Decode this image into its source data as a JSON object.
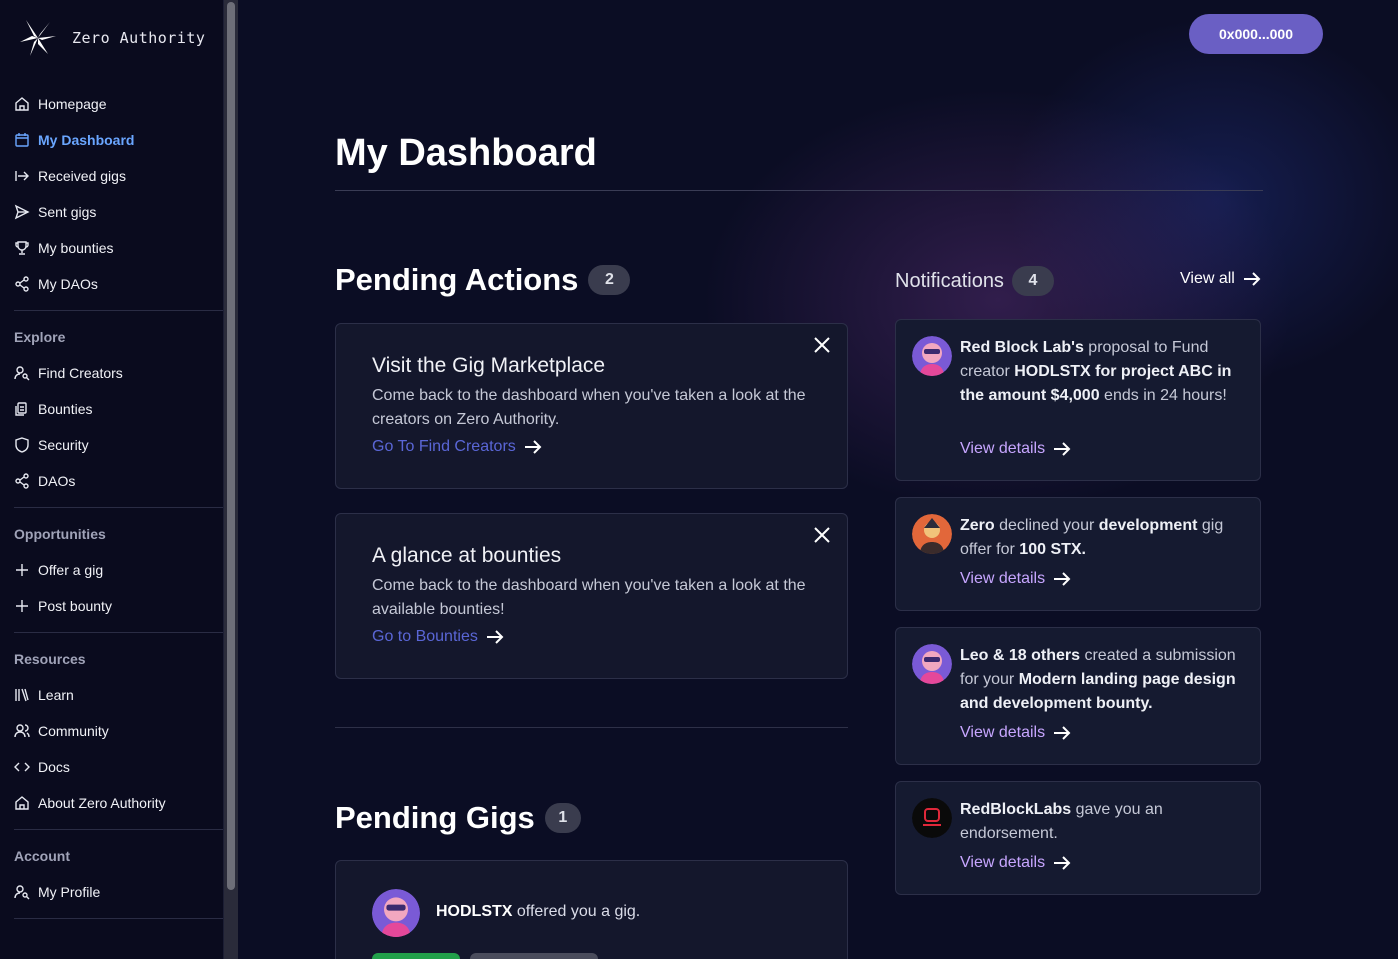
{
  "app": {
    "name": "Zero Authority"
  },
  "sidebar": {
    "primary": [
      {
        "label": "Homepage",
        "icon": "home-icon"
      },
      {
        "label": "My Dashboard",
        "icon": "calendar-icon",
        "active": true
      },
      {
        "label": "Received gigs",
        "icon": "arrow-in-icon"
      },
      {
        "label": "Sent gigs",
        "icon": "send-icon"
      },
      {
        "label": "My bounties",
        "icon": "trophy-icon"
      },
      {
        "label": "My DAOs",
        "icon": "share-icon"
      }
    ],
    "explore": {
      "heading": "Explore",
      "items": [
        {
          "label": "Find Creators",
          "icon": "user-search-icon"
        },
        {
          "label": "Bounties",
          "icon": "bounty-icon"
        },
        {
          "label": "Security",
          "icon": "shield-icon"
        },
        {
          "label": "DAOs",
          "icon": "share-icon"
        }
      ]
    },
    "opportunities": {
      "heading": "Opportunities",
      "items": [
        {
          "label": "Offer a gig",
          "icon": "plus-icon"
        },
        {
          "label": "Post bounty",
          "icon": "plus-icon"
        }
      ]
    },
    "resources": {
      "heading": "Resources",
      "items": [
        {
          "label": "Learn",
          "icon": "books-icon"
        },
        {
          "label": "Community",
          "icon": "users-icon"
        },
        {
          "label": "Docs",
          "icon": "code-icon"
        },
        {
          "label": "About Zero Authority",
          "icon": "home-icon"
        }
      ]
    },
    "account": {
      "heading": "Account",
      "items": [
        {
          "label": "My Profile",
          "icon": "user-search-icon"
        }
      ]
    }
  },
  "header": {
    "wallet": "0x000...000"
  },
  "main": {
    "title": "My Dashboard",
    "pending_actions": {
      "title": "Pending Actions",
      "count": "2",
      "cards": [
        {
          "title": "Visit the Gig Marketplace",
          "body": "Come back to the dashboard when you've taken a look at the creators on Zero Authority.",
          "link": "Go To Find Creators"
        },
        {
          "title": "A glance at bounties",
          "body": "Come back to the dashboard when you've taken a look at the available bounties!",
          "link": "Go to Bounties"
        }
      ]
    },
    "pending_gigs": {
      "title": "Pending Gigs",
      "count": "1",
      "gig": {
        "name": "HODLSTX",
        "text": " offered you a gig."
      }
    },
    "notifications": {
      "title": "Notifications",
      "count": "4",
      "view_all": "View all",
      "view_details": "View details"
    }
  },
  "colors": {
    "accent": "#6a5fc4",
    "link": "#5a66d6",
    "notif_link": "#c7a6ff",
    "active_nav": "#6aa6ff"
  }
}
